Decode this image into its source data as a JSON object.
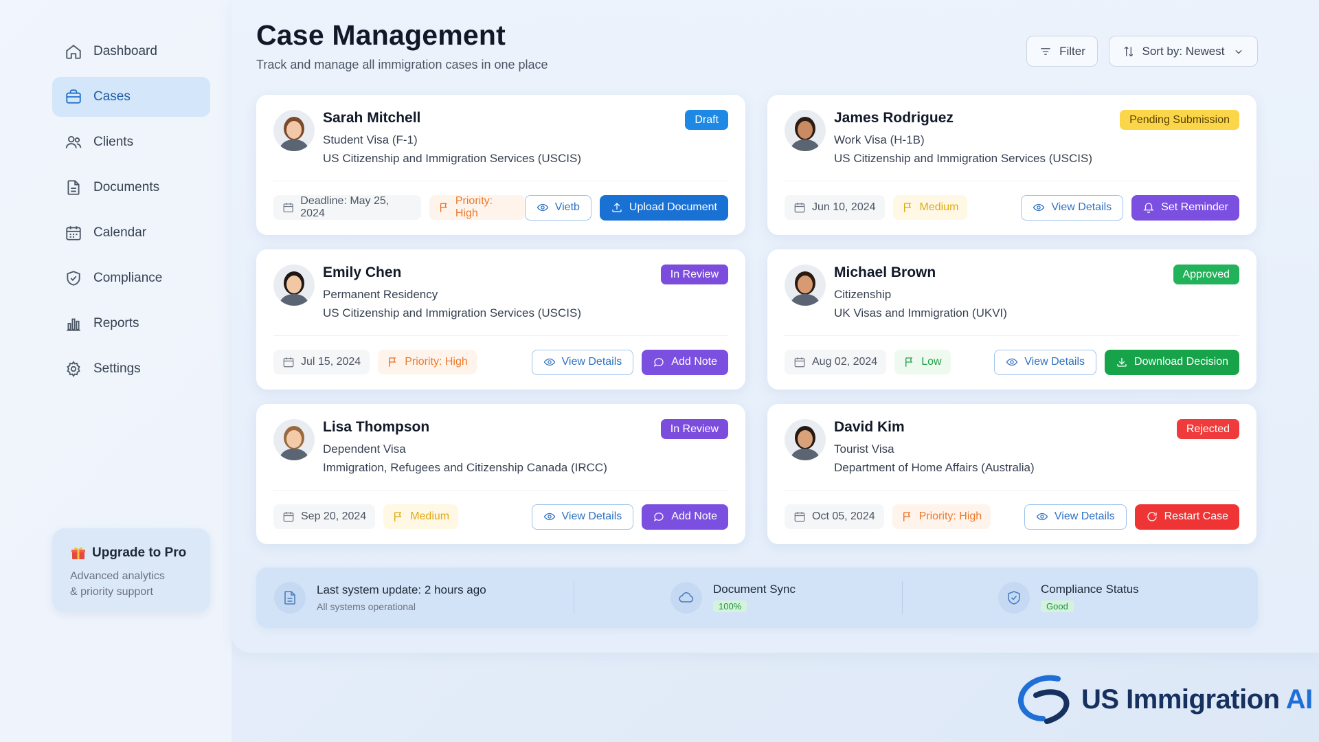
{
  "sidebar": {
    "items": [
      {
        "label": "Dashboard",
        "icon": "home-icon"
      },
      {
        "label": "Cases",
        "icon": "briefcase-icon",
        "active": true
      },
      {
        "label": "Clients",
        "icon": "users-icon"
      },
      {
        "label": "Documents",
        "icon": "document-icon"
      },
      {
        "label": "Calendar",
        "icon": "calendar-icon"
      },
      {
        "label": "Compliance",
        "icon": "shield-icon"
      },
      {
        "label": "Reports",
        "icon": "bar-chart-icon"
      },
      {
        "label": "Settings",
        "icon": "gear-icon"
      }
    ],
    "upgrade": {
      "title": "Upgrade to Pro",
      "line1": "Advanced analytics",
      "line2": "& priority support",
      "icon": "gift-icon"
    }
  },
  "header": {
    "title": "Case Management",
    "subtitle": "Track and manage all immigration cases in one place",
    "filter_label": "Filter",
    "sort_label": "Sort by: Newest"
  },
  "cases": [
    {
      "name": "Sarah Mitchell",
      "visa": "Student Visa (F-1)",
      "agency": "US Citizenship and Immigration Services (USCIS)",
      "status": "Draft",
      "status_color": "#1e88e5",
      "date": "Deadline: May 25, 2024",
      "priority": "Priority: High",
      "priority_level": "high",
      "view_label": "Vietb",
      "action_label": "Upload Document",
      "action_color": "#1971d4",
      "action_icon": "upload-icon"
    },
    {
      "name": "James Rodriguez",
      "visa": "Work Visa (H-1B)",
      "agency": "US Citizenship and Immigration Services (USCIS)",
      "status": "Pending Submission",
      "status_color": "#fbd54a",
      "date": "Jun 10, 2024",
      "priority": "Medium",
      "priority_level": "med",
      "view_label": "View Details",
      "action_label": "Set Reminder",
      "action_color": "#7b4fe0",
      "action_icon": "bell-icon"
    },
    {
      "name": "Emily Chen",
      "visa": "Permanent Residency",
      "agency": "US Citizenship and Immigration Services (USCIS)",
      "status": "In Review",
      "status_color": "#7c4ddd",
      "date": "Jul 15, 2024",
      "priority": "Priority: High",
      "priority_level": "high",
      "view_label": "View Details",
      "action_label": "Add Note",
      "action_color": "#7b4fe0",
      "action_icon": "comment-icon"
    },
    {
      "name": "Michael Brown",
      "visa": "Citizenship",
      "agency": "UK Visas and Immigration (UKVI)",
      "status": "Approved",
      "status_color": "#22b35a",
      "date": "Aug 02, 2024",
      "priority": "Low",
      "priority_level": "low",
      "view_label": "View Details",
      "action_label": "Download Decision",
      "action_color": "#16a34a",
      "action_icon": "download-icon"
    },
    {
      "name": "Lisa Thompson",
      "visa": "Dependent Visa",
      "agency": "Immigration, Refugees and Citizenship Canada (IRCC)",
      "status": "In Review",
      "status_color": "#7c4ddd",
      "date": "Sep 20, 2024",
      "priority": "Medium",
      "priority_level": "med",
      "view_label": "View Details",
      "action_label": "Add Note",
      "action_color": "#7b4fe0",
      "action_icon": "comment-icon"
    },
    {
      "name": "David Kim",
      "visa": "Tourist Visa",
      "agency": "Department of Home Affairs (Australia)",
      "status": "Rejected",
      "status_color": "#ef3b3b",
      "date": "Oct 05, 2024",
      "priority": "Priority: High",
      "priority_level": "high",
      "view_label": "View Details",
      "action_label": "Restart Case",
      "action_color": "#ee3434",
      "action_icon": "restart-icon"
    }
  ],
  "status_bar": {
    "update": {
      "title": "Last system update: 2 hours ago",
      "sub": "All systems operational"
    },
    "sync": {
      "title": "Document Sync",
      "badge": "100%"
    },
    "compliance": {
      "title": "Compliance Status",
      "badge": "Good"
    }
  },
  "brand": {
    "name": "US Immigration",
    "suffix": "AI"
  }
}
